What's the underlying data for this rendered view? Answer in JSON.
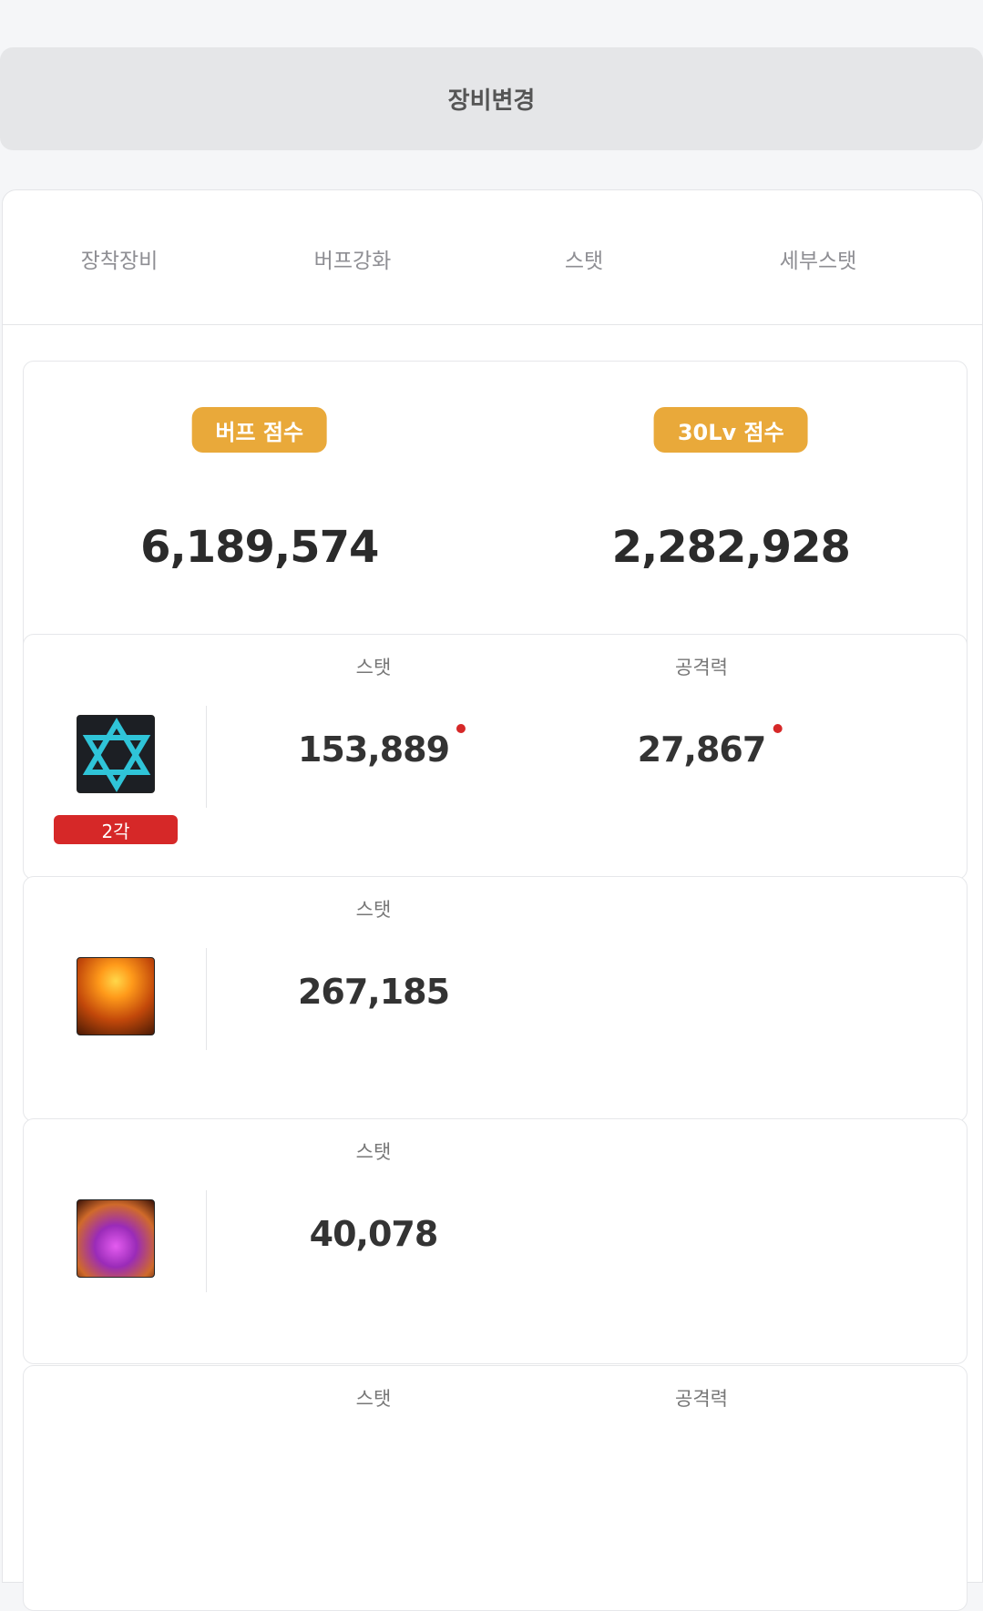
{
  "header": {
    "change_equipment_label": "장비변경"
  },
  "tabs": [
    {
      "label": "장착장비"
    },
    {
      "label": "버프강화"
    },
    {
      "label": "스탯"
    },
    {
      "label": "세부스탯"
    }
  ],
  "scores": {
    "buff": {
      "label": "버프 점수",
      "value": "6,189,574"
    },
    "lv30": {
      "label": "30Lv 점수",
      "value": "2,282,928"
    }
  },
  "buffs": [
    {
      "icon": "hexagram-icon",
      "badge": "2각",
      "stat_label": "스탯",
      "stat_value": "153,889",
      "stat_dot": true,
      "atk_label": "공격력",
      "atk_value": "27,867",
      "atk_dot": true
    },
    {
      "icon": "sunburst-icon",
      "stat_label": "스탯",
      "stat_value": "267,185"
    },
    {
      "icon": "magic-sigil-icon",
      "stat_label": "스탯",
      "stat_value": "40,078"
    },
    {
      "stat_label": "스탯",
      "atk_label": "공격력"
    }
  ],
  "colors": {
    "accent": "#e9a93a",
    "badge_red": "#d62828"
  }
}
